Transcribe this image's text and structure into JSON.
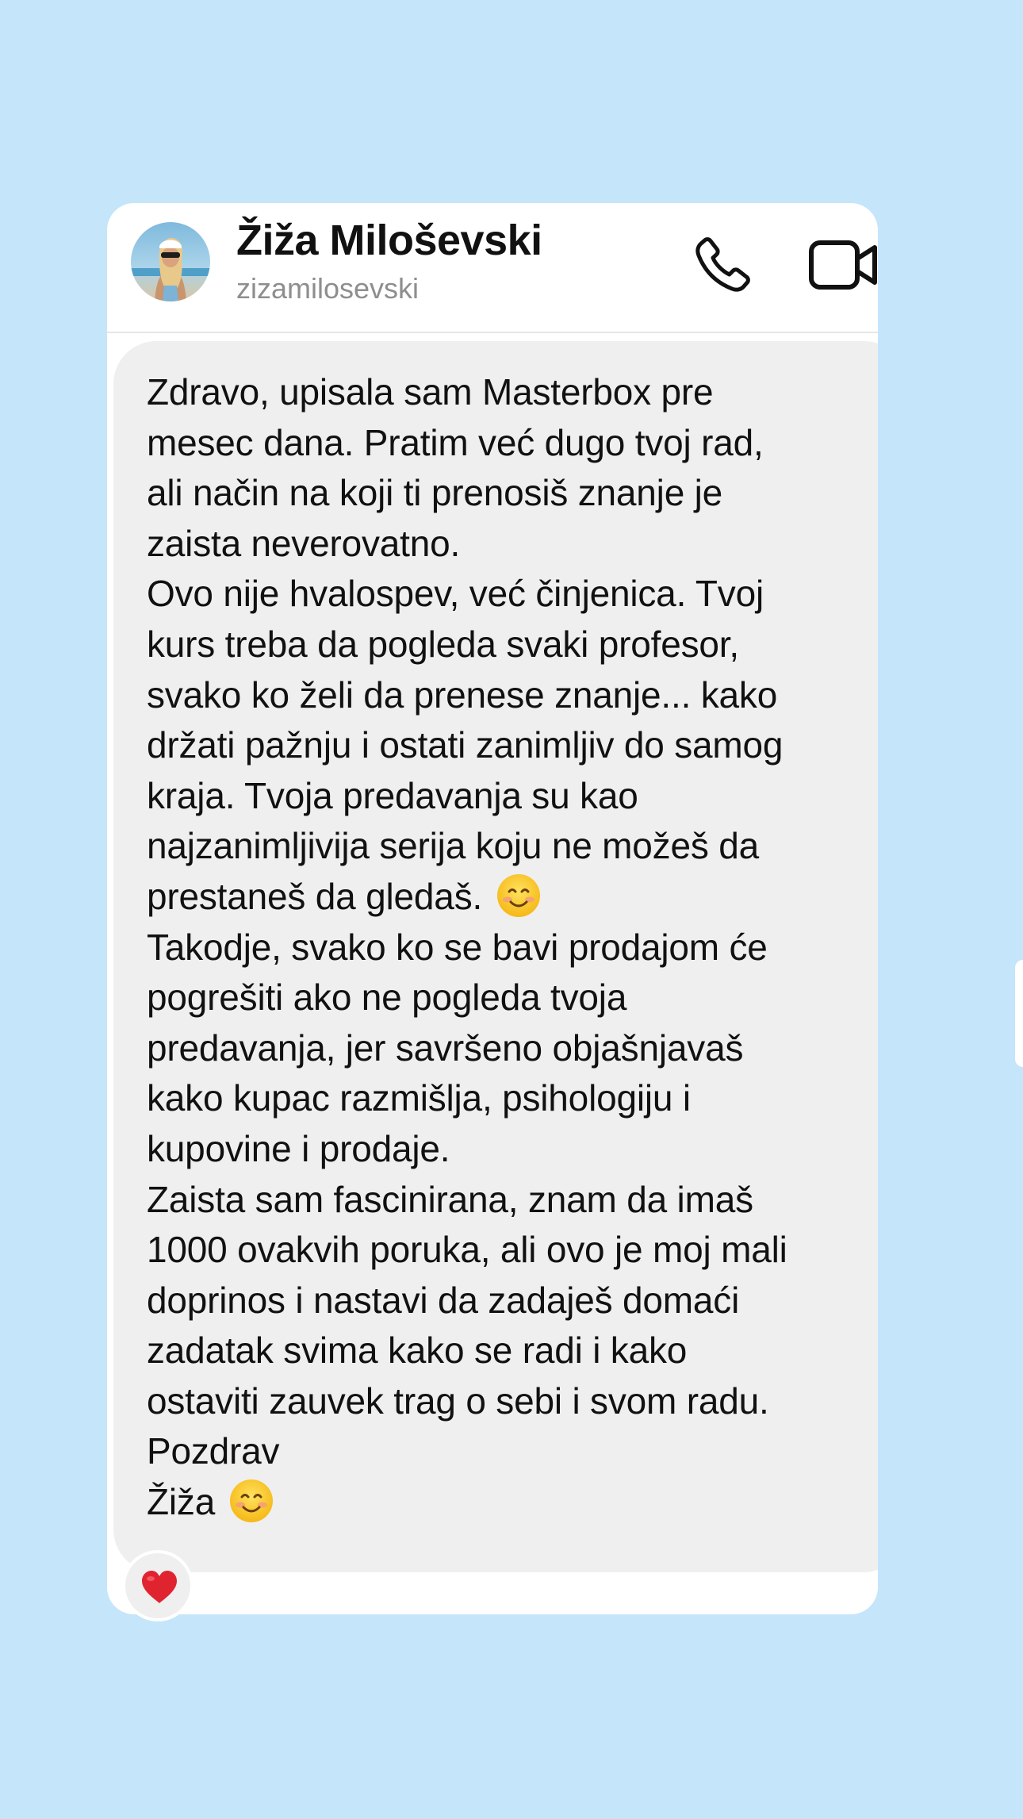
{
  "contact": {
    "name": "Žiža Miloševski",
    "username": "zizamilosevski"
  },
  "icons": {
    "avatar": "avatar",
    "call": "phone-icon",
    "video": "video-camera-icon",
    "emoji": "smiling-face-emoji",
    "reaction": "red-heart-emoji"
  },
  "message": {
    "lines": [
      "Zdravo, upisala sam Masterbox pre",
      "mesec dana. Pratim već dugo tvoj rad,",
      "ali način na koji ti prenosiš znanje je",
      "zaista neverovatno.",
      "Ovo nije hvalospev, već činjenica. Tvoj",
      "kurs treba da pogleda svaki profesor,",
      "svako ko želi da prenese znanje... kako",
      "držati pažnju i ostati zanimljiv do samog",
      "kraja. Tvoja predavanja su kao",
      "najzanimljivija serija koju ne možeš da",
      "prestaneš da gledaš.",
      "Takodje, svako ko se bavi prodajom će",
      "pogrešiti ako ne pogleda tvoja",
      "predavanja, jer savršeno objašnjavaš",
      "kako kupac razmišlja, psihologiju i",
      "kupovine i prodaje.",
      "Zaista sam fascinirana, znam da imaš",
      "1000 ovakvih poruka, ali ovo je moj mali",
      "doprinos i nastavi da zadaješ domaći",
      "zadatak svima kako se radi i kako",
      "ostaviti zauvek trag o sebi i svom radu.",
      "Pozdrav",
      "Žiža"
    ]
  },
  "colors": {
    "background": "#c4e5fa",
    "card": "#ffffff",
    "bubble": "#efefef",
    "heart": "#e0242f"
  }
}
